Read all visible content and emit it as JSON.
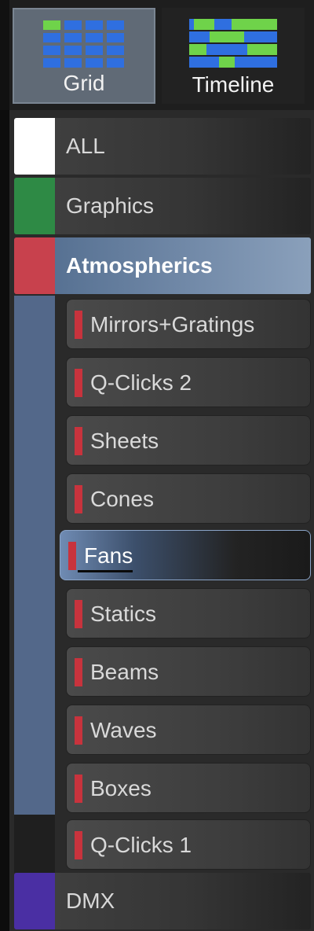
{
  "view_toggle": {
    "grid_label": "Grid",
    "timeline_label": "Timeline",
    "active": "Grid"
  },
  "categories": [
    {
      "label": "ALL",
      "color": "#ffffff"
    },
    {
      "label": "Graphics",
      "color": "#2e8a45"
    },
    {
      "label": "Atmospherics",
      "color": "#c8414d",
      "active": true
    },
    {
      "label": "DMX",
      "color": "#4a2fa3"
    }
  ],
  "subcategories": [
    {
      "label": "Mirrors+Gratings",
      "color": "#c8333d"
    },
    {
      "label": "Q-Clicks 2",
      "color": "#c8333d"
    },
    {
      "label": "Sheets",
      "color": "#c8333d"
    },
    {
      "label": "Cones",
      "color": "#c8333d"
    },
    {
      "label": "Fans",
      "color": "#c8333d",
      "selected": true
    },
    {
      "label": "Statics",
      "color": "#c8333d"
    },
    {
      "label": "Beams",
      "color": "#c8333d"
    },
    {
      "label": "Waves",
      "color": "#c8333d"
    },
    {
      "label": "Boxes",
      "color": "#c8333d"
    },
    {
      "label": "Q-Clicks 1",
      "color": "#c8333d"
    }
  ],
  "icons": {
    "grid": "grid-view-icon",
    "timeline": "timeline-view-icon"
  }
}
